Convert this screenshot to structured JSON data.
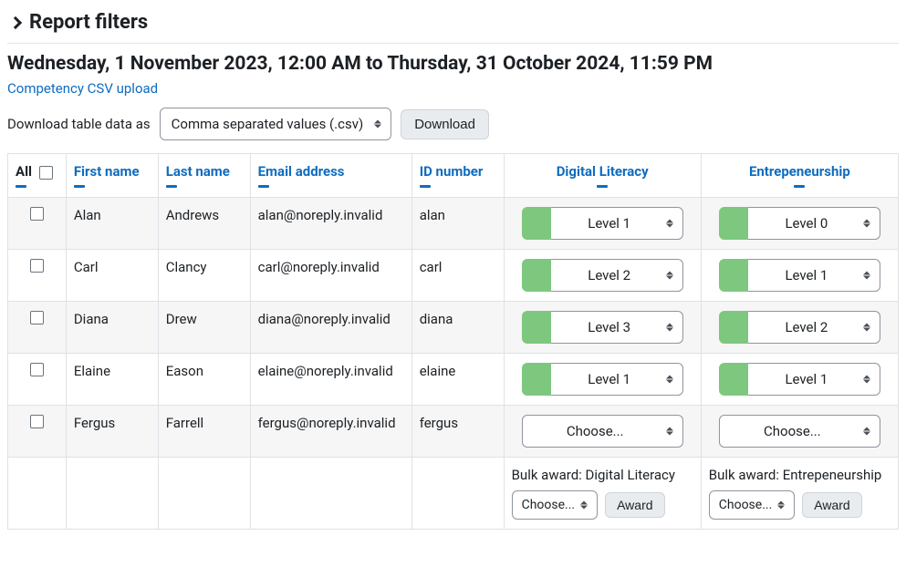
{
  "filters": {
    "title": "Report filters"
  },
  "dateRange": "Wednesday, 1 November 2023, 12:00 AM to Thursday, 31 October 2024, 11:59 PM",
  "csvLink": "Competency CSV upload",
  "download": {
    "label": "Download table data as",
    "format": "Comma separated values (.csv)",
    "button": "Download"
  },
  "columns": {
    "all": "All",
    "firstName": "First name",
    "lastName": "Last name",
    "email": "Email address",
    "id": "ID number",
    "comp1": "Digital Literacy",
    "comp2": "Entrepeneurship"
  },
  "rows": [
    {
      "firstName": "Alan",
      "lastName": "Andrews",
      "email": "alan@noreply.invalid",
      "id": "alan",
      "comp1": "Level 1",
      "comp2": "Level 0",
      "hasLevel": true
    },
    {
      "firstName": "Carl",
      "lastName": "Clancy",
      "email": "carl@noreply.invalid",
      "id": "carl",
      "comp1": "Level 2",
      "comp2": "Level 1",
      "hasLevel": true
    },
    {
      "firstName": "Diana",
      "lastName": "Drew",
      "email": "diana@noreply.invalid",
      "id": "diana",
      "comp1": "Level 3",
      "comp2": "Level 2",
      "hasLevel": true
    },
    {
      "firstName": "Elaine",
      "lastName": "Eason",
      "email": "elaine@noreply.invalid",
      "id": "elaine",
      "comp1": "Level 1",
      "comp2": "Level 1",
      "hasLevel": true
    },
    {
      "firstName": "Fergus",
      "lastName": "Farrell",
      "email": "fergus@noreply.invalid",
      "id": "fergus",
      "comp1": "Choose...",
      "comp2": "Choose...",
      "hasLevel": false
    }
  ],
  "bulk": {
    "label1": "Bulk award: Digital Literacy",
    "label2": "Bulk award: Entrepeneurship",
    "choose": "Choose...",
    "awardBtn": "Award"
  }
}
